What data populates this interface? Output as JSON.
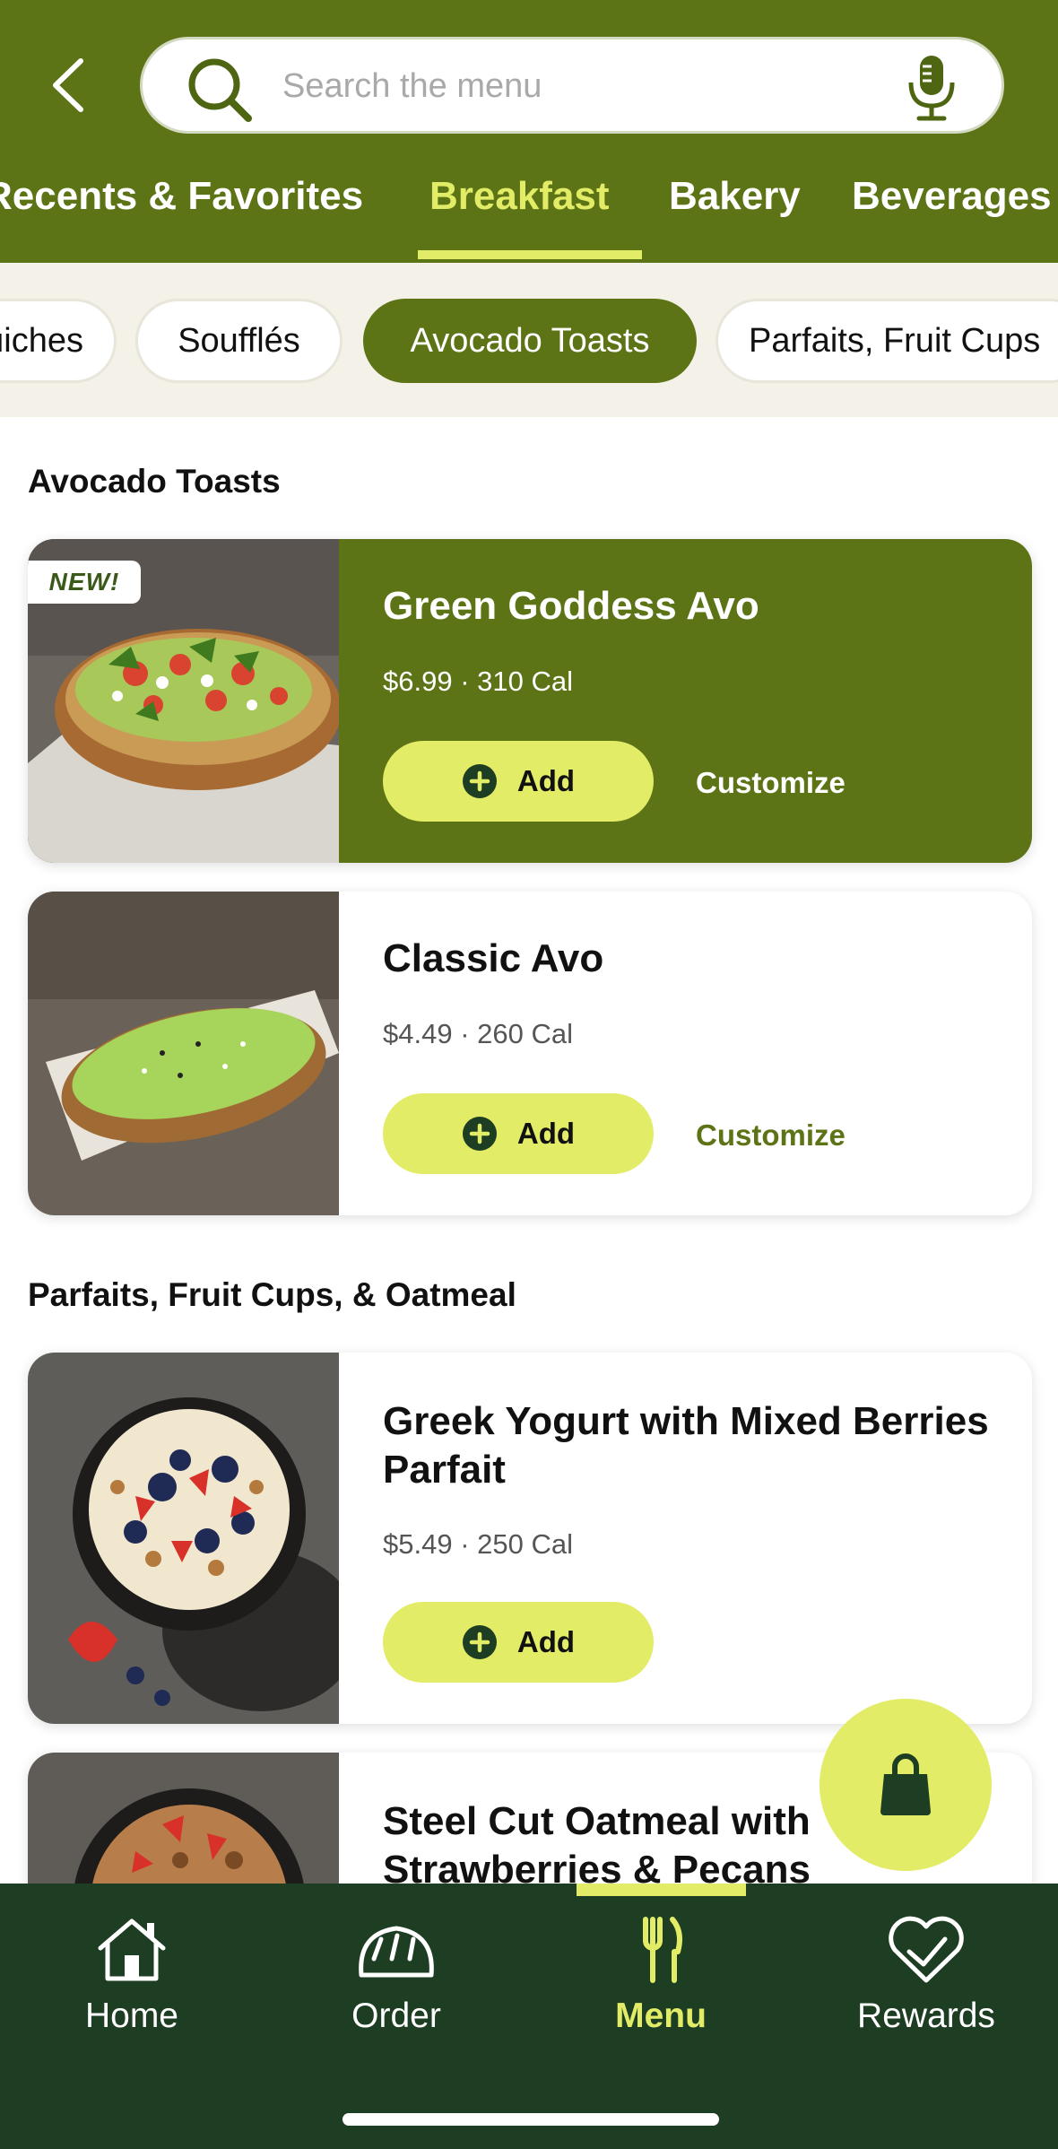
{
  "header": {
    "back_icon": "chevron-left-icon",
    "search": {
      "placeholder": "Search the menu",
      "value": "",
      "icon": "search-icon",
      "mic_icon": "mic-icon"
    },
    "tabs": [
      {
        "label": "Recents & Favorites",
        "active": false
      },
      {
        "label": "Breakfast",
        "active": true
      },
      {
        "label": "Bakery",
        "active": false
      },
      {
        "label": "Beverages",
        "active": false
      }
    ]
  },
  "subcategories": [
    {
      "label": "Quiches",
      "active": false
    },
    {
      "label": "Soufflés",
      "active": false
    },
    {
      "label": "Avocado Toasts",
      "active": true
    },
    {
      "label": "Parfaits, Fruit Cups",
      "active": false
    }
  ],
  "sections": [
    {
      "title": "Avocado Toasts",
      "items": [
        {
          "badge": "NEW!",
          "name": "Green Goddess Avo",
          "meta": "$6.99 · 310 Cal",
          "add_label": "Add",
          "customize_label": "Customize",
          "featured": true
        },
        {
          "name": "Classic Avo",
          "meta": "$4.49 · 260 Cal",
          "add_label": "Add",
          "customize_label": "Customize"
        }
      ]
    },
    {
      "title": "Parfaits, Fruit Cups, & Oatmeal",
      "items": [
        {
          "name": "Greek Yogurt with Mixed Berries Parfait",
          "meta": "$5.49 · 250 Cal",
          "add_label": "Add"
        },
        {
          "name": "Steel Cut Oatmeal with Strawberries & Pecans"
        }
      ]
    }
  ],
  "cart_icon": "shopping-bag-icon",
  "bottom_nav": [
    {
      "label": "Home",
      "icon": "home-icon",
      "active": false
    },
    {
      "label": "Order",
      "icon": "bread-icon",
      "active": false
    },
    {
      "label": "Menu",
      "icon": "fork-knife-icon",
      "active": true
    },
    {
      "label": "Rewards",
      "icon": "heart-rewards-icon",
      "active": false
    }
  ],
  "colors": {
    "brand_green": "#5c7416",
    "accent_yellow": "#e2ec66",
    "nav_dark_green": "#1d3e22",
    "chip_background": "#f4f1e8"
  }
}
